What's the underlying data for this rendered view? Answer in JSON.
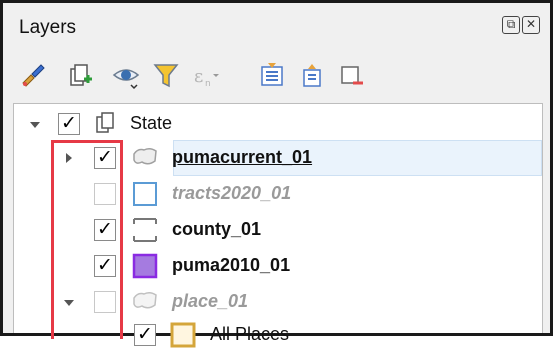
{
  "panel": {
    "title": "Layers",
    "controls": [
      "restore-icon",
      "close-icon"
    ]
  },
  "toolbar": {
    "icons": [
      "style-brush-icon",
      "add-group-icon",
      "visibility-eye-icon",
      "filter-icon",
      "expression-filter-icon",
      "expand-all-icon",
      "collapse-all-icon",
      "remove-layer-icon"
    ]
  },
  "tree": {
    "group": {
      "label": "State",
      "checked": true,
      "expanded": true
    },
    "layers": [
      {
        "label": "pumacurrent_01",
        "checked": true,
        "symbol": "polygon-outline",
        "selected": true
      },
      {
        "label": "tracts2020_01",
        "checked": false,
        "symbol": "blue-square"
      },
      {
        "label": "county_01",
        "checked": true,
        "symbol": "dashed-square"
      },
      {
        "label": "puma2010_01",
        "checked": true,
        "symbol": "purple-square",
        "symbol_color": "#a57be0"
      },
      {
        "label": "place_01",
        "checked": false,
        "symbol": "polygon-outline",
        "expanded": true
      },
      {
        "label": "All Places",
        "checked": true,
        "symbol": "gold-square",
        "symbol_color": "#d4a53a"
      }
    ]
  },
  "highlight_color": "#e63946"
}
